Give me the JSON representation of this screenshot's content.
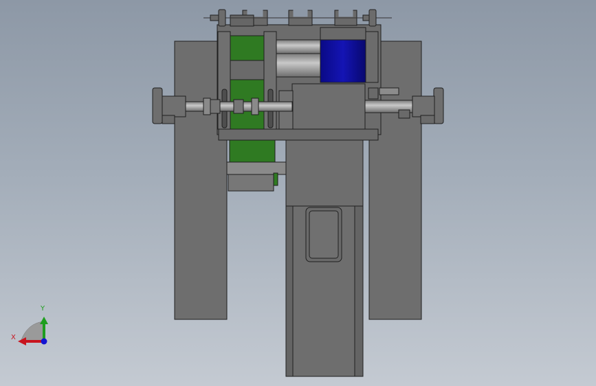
{
  "viewport": {
    "view_orientation": "front",
    "background_top": "#8d98a6",
    "background_bottom": "#c4cad2"
  },
  "model": {
    "body_color": "#6e6e6e",
    "edge_color": "#1f1f1f",
    "shaft_color": "#a9a9a9",
    "accent_green": "#2f7a22",
    "accent_blue": "#0c0a9c"
  },
  "triad": {
    "x_label": "X",
    "y_label": "Y",
    "x_color": "#c8141e",
    "y_color": "#1e9e1e",
    "z_color": "#1414d2",
    "icon": "coordinate-triad-icon"
  }
}
